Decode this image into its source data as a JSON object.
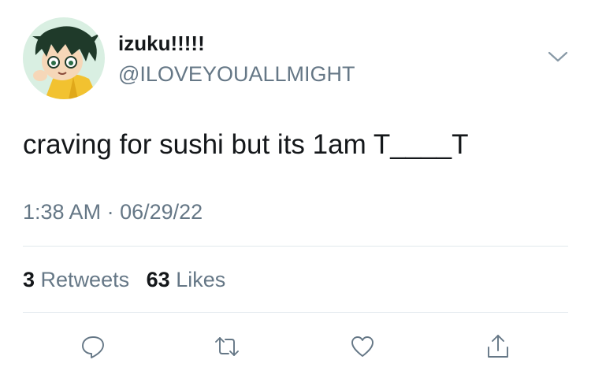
{
  "tweet": {
    "display_name": "izuku!!!!!",
    "handle": "@ILOVEYOUALLMIGHT",
    "text": "craving for sushi but its 1am T____T",
    "time": "1:38 AM",
    "separator": "·",
    "date": "06/29/22",
    "retweets": "3",
    "retweets_label": "Retweets",
    "likes": "63",
    "likes_label": "Likes"
  },
  "icons": {
    "caret": "chevron-down-icon",
    "reply": "reply-icon",
    "retweet": "retweet-icon",
    "like": "heart-icon",
    "share": "share-icon"
  },
  "colors": {
    "text": "#14171a",
    "secondary": "#657786",
    "divider": "#e1e8ed",
    "background": "#ffffff"
  }
}
